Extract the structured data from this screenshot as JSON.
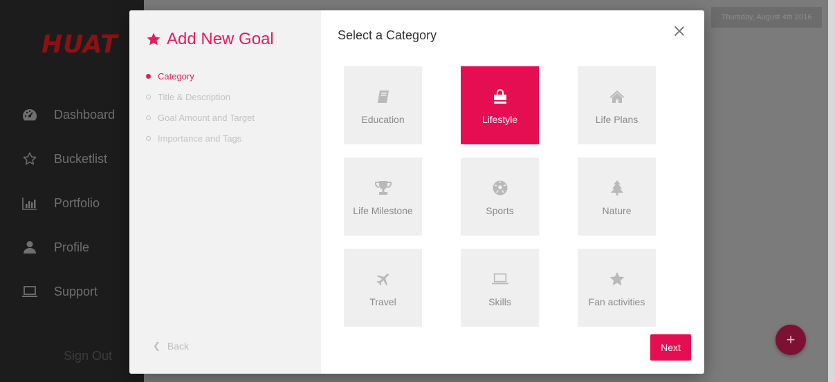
{
  "app": {
    "logo": "HUAT",
    "date": "Thursday, August 4th 2016",
    "nav": [
      {
        "label": "Dashboard",
        "icon": "dashboard-icon"
      },
      {
        "label": "Bucketlist",
        "icon": "star-outline-icon"
      },
      {
        "label": "Portfolio",
        "icon": "bar-chart-icon"
      },
      {
        "label": "Profile",
        "icon": "user-icon"
      },
      {
        "label": "Support",
        "icon": "laptop-icon"
      }
    ],
    "sign_out": "Sign Out",
    "fab_label": "+"
  },
  "modal": {
    "title": "Add New Goal",
    "steps": [
      {
        "label": "Category",
        "active": true
      },
      {
        "label": "Title & Description",
        "active": false
      },
      {
        "label": "Goal Amount and Target",
        "active": false
      },
      {
        "label": "Importance and Tags",
        "active": false
      }
    ],
    "back_label": "Back",
    "heading": "Select a Category",
    "categories": [
      {
        "label": "Education",
        "icon": "book-icon",
        "selected": false
      },
      {
        "label": "Lifestyle",
        "icon": "shopping-bag-icon",
        "selected": true
      },
      {
        "label": "Life Plans",
        "icon": "home-icon",
        "selected": false
      },
      {
        "label": "Life Milestone",
        "icon": "trophy-icon",
        "selected": false
      },
      {
        "label": "Sports",
        "icon": "soccer-ball-icon",
        "selected": false
      },
      {
        "label": "Nature",
        "icon": "tree-icon",
        "selected": false
      },
      {
        "label": "Travel",
        "icon": "plane-icon",
        "selected": false
      },
      {
        "label": "Skills",
        "icon": "laptop-icon",
        "selected": false
      },
      {
        "label": "Fan activities",
        "icon": "star-icon",
        "selected": false
      }
    ],
    "next_label": "Next"
  },
  "colors": {
    "accent": "#e50e52",
    "title": "#e41d5c",
    "tile_bg": "#efefef",
    "sidebar_bg": "#1c1c1c"
  }
}
